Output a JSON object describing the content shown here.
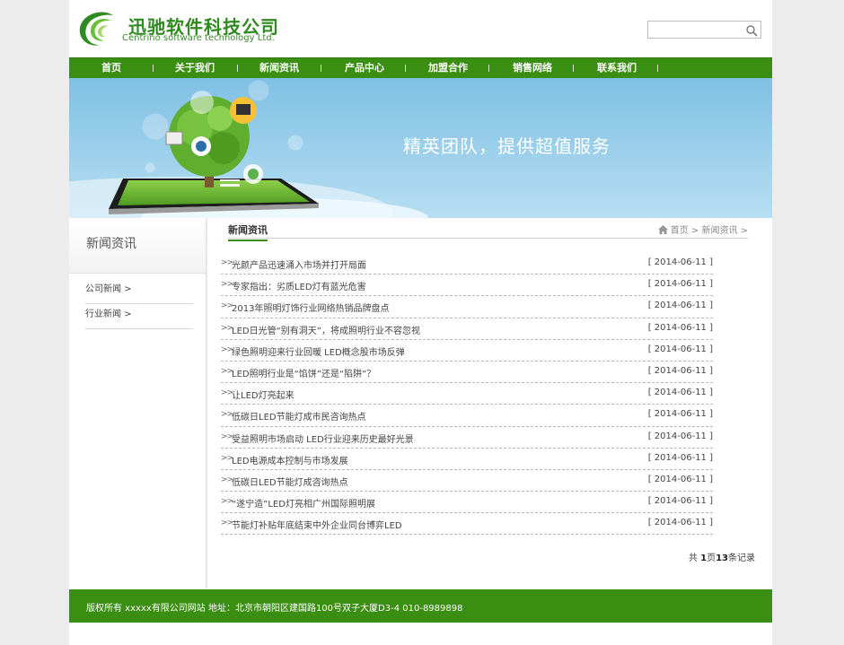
{
  "header": {
    "company_name": "迅驰软件科技公司",
    "company_name_en": "Centrino software technology Ltd.",
    "search_placeholder": ""
  },
  "nav": {
    "items": [
      {
        "label": "首页"
      },
      {
        "label": "关于我们"
      },
      {
        "label": "新闻资讯"
      },
      {
        "label": "产品中心"
      },
      {
        "label": "加盟合作"
      },
      {
        "label": "销售网络"
      },
      {
        "label": "联系我们"
      }
    ]
  },
  "banner": {
    "slogan": "精英团队，提供超值服务"
  },
  "sidebar": {
    "title": "新闻资讯",
    "items": [
      {
        "label": "公司新闻  >"
      },
      {
        "label": "行业新闻  >"
      }
    ]
  },
  "content": {
    "section_title": "新闻资讯",
    "breadcrumb": "首页 > 新闻资讯 >",
    "news": [
      {
        "title": "光颜产品迅速涌入市场并打开局面",
        "date": "[ 2014-06-11 ]"
      },
      {
        "title": "专家指出：劣质LED灯有蓝光危害",
        "date": "[ 2014-06-11 ]"
      },
      {
        "title": "2013年照明灯饰行业网络热销品牌盘点",
        "date": "[ 2014-06-11 ]"
      },
      {
        "title": "LED日光管“别有洞天”，将成照明行业不容忽视",
        "date": "[ 2014-06-11 ]"
      },
      {
        "title": "绿色照明迎来行业回暖 LED概念股市场反弹",
        "date": "[ 2014-06-11 ]"
      },
      {
        "title": "LED照明行业是“馅饼”还是“陷阱”？",
        "date": "[ 2014-06-11 ]"
      },
      {
        "title": "让LED灯亮起来",
        "date": "[ 2014-06-11 ]"
      },
      {
        "title": "低碳日LED节能灯成市民咨询热点",
        "date": "[ 2014-06-11 ]"
      },
      {
        "title": "受益照明市场启动 LED行业迎来历史最好光景",
        "date": "[ 2014-06-11 ]"
      },
      {
        "title": "LED电源成本控制与市场发展",
        "date": "[ 2014-06-11 ]"
      },
      {
        "title": "低碳日LED节能灯成咨询热点",
        "date": "[ 2014-06-11 ]"
      },
      {
        "title": "“遂宁造”LED灯亮相广州国际照明展",
        "date": "[ 2014-06-11 ]"
      },
      {
        "title": "节能灯补贴年底结束中外企业同台博弈LED",
        "date": "[ 2014-06-11 ]"
      }
    ],
    "pager": {
      "prefix": "共 ",
      "pages": "1",
      "mid1": "页",
      "records": "13",
      "suffix": "条记录"
    }
  },
  "footer": {
    "text": "版权所有 xxxxx有限公司网站 地址：北京市朝阳区建国路100号双子大厦D3-4 010-8989898"
  },
  "colors": {
    "brand_green": "#3a8e12",
    "banner_sky": "#8cc8e8"
  }
}
